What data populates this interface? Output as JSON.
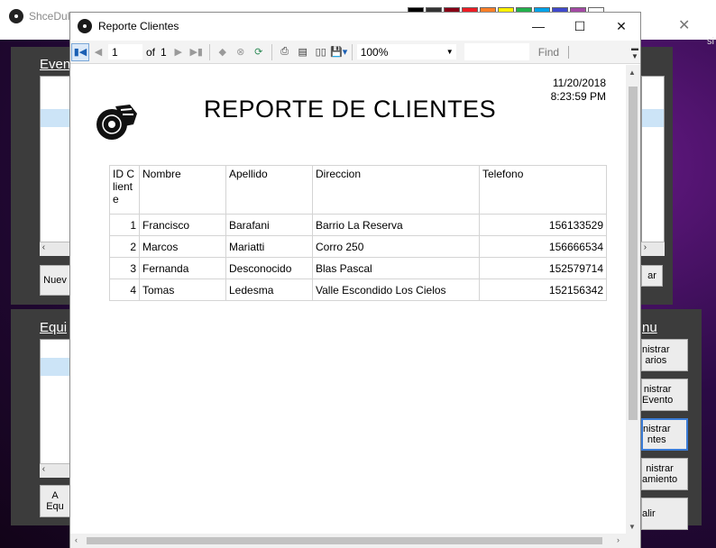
{
  "background_app": {
    "title": "ShceDul",
    "section_labels": [
      "Even",
      "Equi",
      "nu"
    ],
    "buttons": [
      "Nuev",
      "ar",
      "A\nEqu",
      "nistrar\narios",
      "nistrar\nEvento",
      "nistrar\nntes",
      "nistrar\namiento",
      "alir"
    ],
    "close_glyph": "✕",
    "right_edge_text": "si"
  },
  "window": {
    "title": "Reporte Clientes",
    "controls": {
      "minimize": "—",
      "maximize": "☐",
      "close": "✕"
    }
  },
  "toolbar": {
    "page_current": "1",
    "page_of_label": "of",
    "page_total": "1",
    "zoom": "100%",
    "find_label": "Find"
  },
  "report": {
    "date": "11/20/2018",
    "time": "8:23:59 PM",
    "title": "REPORTE DE CLIENTES",
    "columns": [
      "ID Cliente",
      "Nombre",
      "Apellido",
      "Direccion",
      "Telefono"
    ],
    "rows": [
      {
        "id": "1",
        "nombre": "Francisco",
        "apellido": "Barafani",
        "direccion": "Barrio La Reserva",
        "telefono": "156133529"
      },
      {
        "id": "2",
        "nombre": "Marcos",
        "apellido": "Mariatti",
        "direccion": "Corro 250",
        "telefono": "156666534"
      },
      {
        "id": "3",
        "nombre": "Fernanda",
        "apellido": "Desconocido",
        "direccion": "Blas Pascal",
        "telefono": "152579714"
      },
      {
        "id": "4",
        "nombre": "Tomas",
        "apellido": "Ledesma",
        "direccion": "Valle Escondido Los Cielos",
        "telefono": "152156342"
      }
    ]
  },
  "colors": {
    "accent": "#1a5fb4",
    "selection": "#cce4f7",
    "panel": "#3c3c3c"
  }
}
